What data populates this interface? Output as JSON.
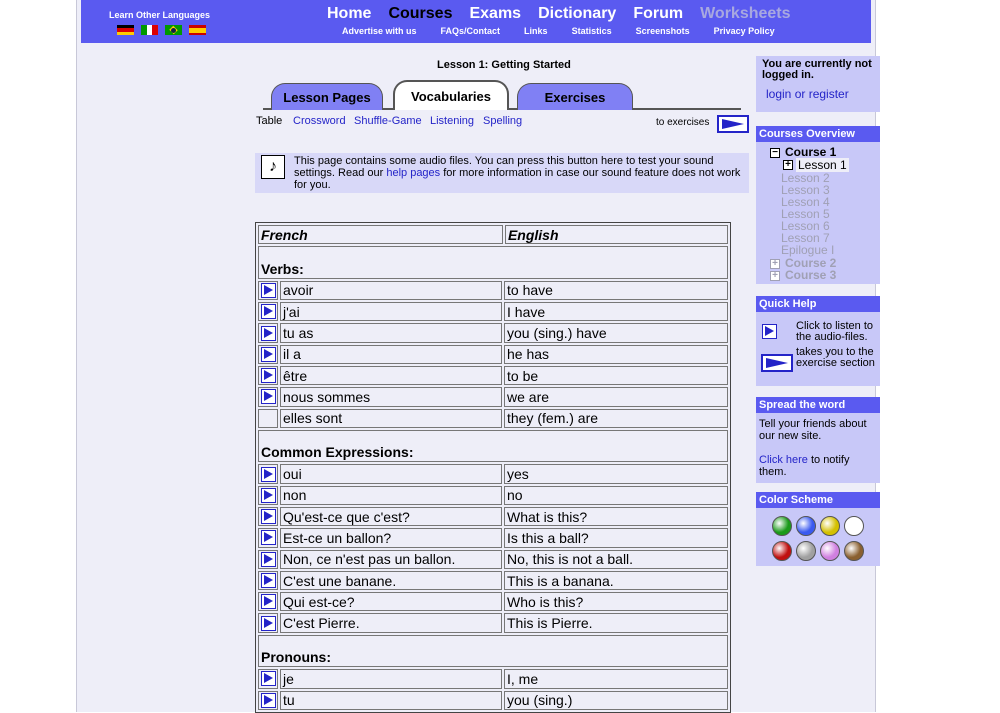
{
  "header": {
    "languages_label": "Learn Other Languages",
    "flags": [
      "german-flag",
      "italian-flag",
      "brazilian-flag",
      "spanish-flag"
    ],
    "nav": [
      "Home",
      "Courses",
      "Exams",
      "Dictionary",
      "Forum",
      "Worksheets"
    ],
    "subnav": [
      "Advertise with us",
      "FAQs/Contact",
      "Links",
      "Statistics",
      "Screenshots",
      "Privacy Policy"
    ]
  },
  "lesson": {
    "title": "Lesson 1: Getting Started",
    "tabs": [
      "Lesson Pages",
      "Vocabularies",
      "Exercises"
    ],
    "subtabs": {
      "current": "Table",
      "links": [
        "Crossword",
        "Shuffle-Game",
        "Listening",
        "Spelling"
      ],
      "to_exercises": "to exercises"
    },
    "audio_notice": {
      "text_before": "This page contains some audio files. You can press this button here to test your sound settings. Read our ",
      "link": "help pages",
      "text_after": " for more information in case our sound feature does not work for you."
    }
  },
  "vocab": {
    "headers": [
      "French",
      "English"
    ],
    "sections": [
      {
        "title": "Verbs:",
        "rows": [
          {
            "fr": "avoir",
            "en": "to have",
            "audio": true
          },
          {
            "fr": "j'ai",
            "en": "I have",
            "audio": true
          },
          {
            "fr": "tu as",
            "en": "you (sing.) have",
            "audio": true
          },
          {
            "fr": "il a",
            "en": "he has",
            "audio": true
          },
          {
            "fr": "être",
            "en": "to be",
            "audio": true
          },
          {
            "fr": "nous sommes",
            "en": "we are",
            "audio": true
          },
          {
            "fr": "elles sont",
            "en": "they (fem.) are",
            "audio": false
          }
        ]
      },
      {
        "title": "Common Expressions:",
        "rows": [
          {
            "fr": "oui",
            "en": "yes",
            "audio": true
          },
          {
            "fr": "non",
            "en": "no",
            "audio": true
          },
          {
            "fr": "Qu'est-ce que c'est?",
            "en": "What is this?",
            "audio": true
          },
          {
            "fr": "Est-ce un ballon?",
            "en": "Is this a ball?",
            "audio": true
          },
          {
            "fr": "Non, ce n'est pas un ballon.",
            "en": "No, this is not a ball.",
            "audio": true
          },
          {
            "fr": "C'est une banane.",
            "en": "This is a banana.",
            "audio": true
          },
          {
            "fr": "Qui est-ce?",
            "en": "Who is this?",
            "audio": true
          },
          {
            "fr": "C'est Pierre.",
            "en": "This is Pierre.",
            "audio": true
          }
        ]
      },
      {
        "title": "Pronouns:",
        "rows": [
          {
            "fr": "je",
            "en": "I, me",
            "audio": true
          },
          {
            "fr": "tu",
            "en": "you (sing.)",
            "audio": true
          }
        ]
      }
    ]
  },
  "sidebar": {
    "login": {
      "status": "You are currently not logged in.",
      "link": "login or register"
    },
    "courses": {
      "title": "Courses Overview",
      "course1": "Course 1",
      "lessons": [
        "Lesson 1",
        "Lesson 2",
        "Lesson 3",
        "Lesson 4",
        "Lesson 5",
        "Lesson 6",
        "Lesson 7",
        "Epilogue I"
      ],
      "course2": "Course 2",
      "course3": "Course 3"
    },
    "help": {
      "title": "Quick Help",
      "play_text": "Click to listen to the audio-files.",
      "exercise_text": "takes you to the exercise section"
    },
    "spread": {
      "title": "Spread the word",
      "text": "Tell your friends about our new site.",
      "link": "Click here",
      "link_after": " to notify them."
    },
    "scheme": {
      "title": "Color Scheme",
      "colors": [
        "#1a9a1a",
        "#3a5af0",
        "#d4c000",
        "#ffffff",
        "#c01010",
        "#a0a0a0",
        "#d080e0",
        "#8a6030"
      ]
    }
  }
}
